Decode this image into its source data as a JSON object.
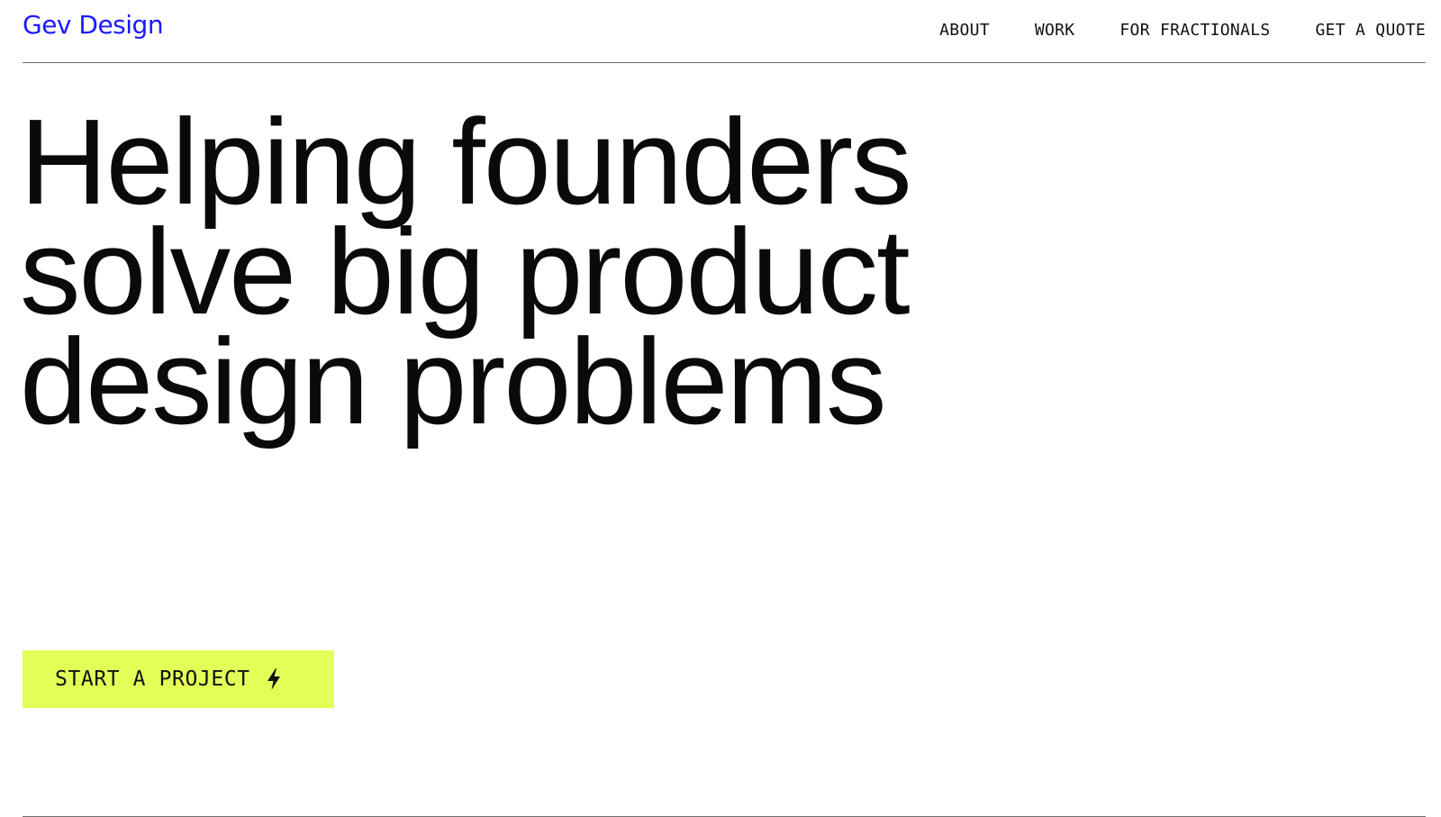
{
  "header": {
    "logo_text": "Gev Design",
    "nav": [
      {
        "label": "ABOUT"
      },
      {
        "label": "WORK"
      },
      {
        "label": "FOR FRACTIONALS"
      },
      {
        "label": "GET A QUOTE"
      }
    ]
  },
  "hero": {
    "lines": [
      "Helping founders",
      "solve big product",
      "design problems"
    ]
  },
  "cta": {
    "label": "START A PROJECT",
    "icon": "lightning-bolt-icon"
  },
  "colors": {
    "logo": "#1a1aff",
    "cta_background": "#e3ff57",
    "text": "#0a0a0a",
    "divider": "#6f6f6f",
    "background": "#ffffff"
  }
}
